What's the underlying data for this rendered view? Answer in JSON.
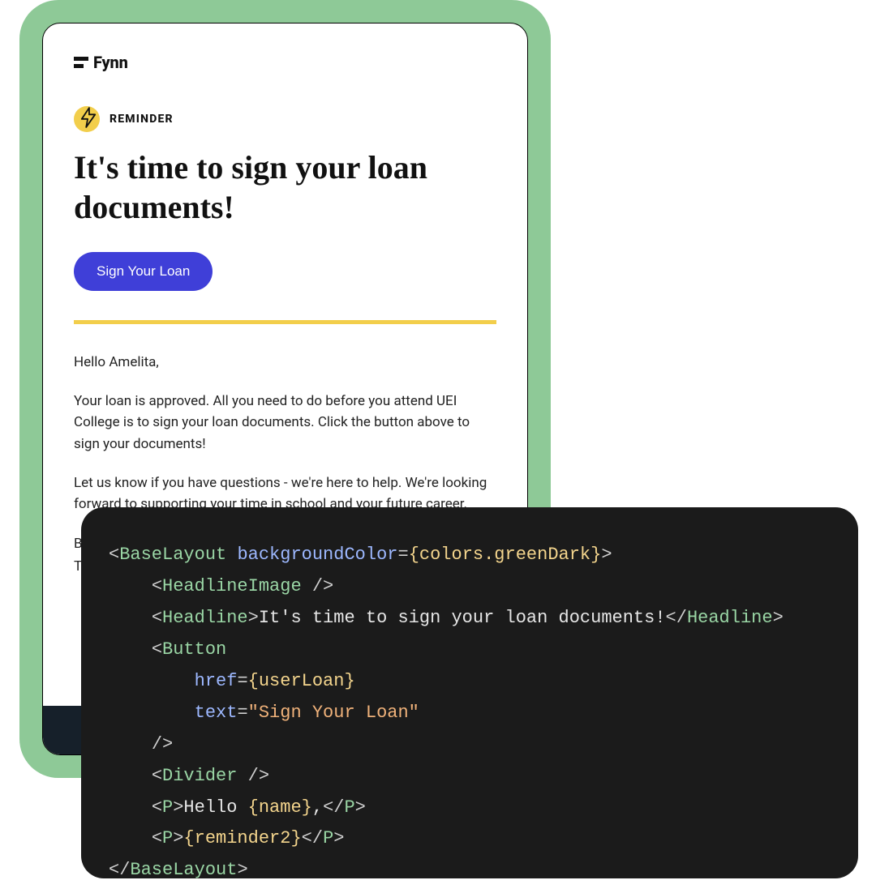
{
  "email": {
    "brand": "Fynn",
    "badge_label": "REMINDER",
    "headline": "It's time to sign your loan documents!",
    "cta_label": "Sign Your Loan",
    "greeting": "Hello Amelita,",
    "p1": "Your loan is approved. All you need to do before you attend UEI College is to sign your loan documents. Click the button above to sign your documents!",
    "p2": "Let us know if you have questions - we're here to help. We're looking forward to supporting your time in school and your future career.",
    "p3": "Best,",
    "p4": "The"
  },
  "code": {
    "l1_open1": "<",
    "l1_tag": "BaseLayout",
    "l1_sp": " ",
    "l1_attr": "backgroundColor",
    "l1_eq": "=",
    "l1_expr": "{colors.greenDark}",
    "l1_close": ">",
    "indent1": "    ",
    "indent2": "        ",
    "l2_open": "<",
    "l2_tag": "HeadlineImage",
    "l2_close": " />",
    "l3_open": "<",
    "l3_tag": "Headline",
    "l3_gt": ">",
    "l3_text": "It's time to sign your loan documents!",
    "l3_close_open": "</",
    "l3_close_gt": ">",
    "l4_open": "<",
    "l4_tag": "Button",
    "l5_attr": "href",
    "l5_eq": "=",
    "l5_expr": "{userLoan}",
    "l6_attr": "text",
    "l6_eq": "=",
    "l6_str": "\"Sign Your Loan\"",
    "l7_close": "/>",
    "l8_open": "<",
    "l8_tag": "Divider",
    "l8_close": " />",
    "l9_open": "<",
    "l9_tag": "P",
    "l9_gt": ">",
    "l9_text1": "Hello ",
    "l9_expr": "{name}",
    "l9_text2": ",",
    "l9_close_open": "</",
    "l9_close_gt": ">",
    "l10_open": "<",
    "l10_tag": "P",
    "l10_gt": ">",
    "l10_expr": "{reminder2}",
    "l10_close_open": "</",
    "l10_close_gt": ">",
    "l11_open": "</",
    "l11_tag": "BaseLayout",
    "l11_gt": ">"
  },
  "colors": {
    "frame_bg": "#8ec997",
    "accent_yellow": "#F2CE4B",
    "button_bg": "#3F3FD8",
    "code_bg": "#1B1B1B"
  }
}
